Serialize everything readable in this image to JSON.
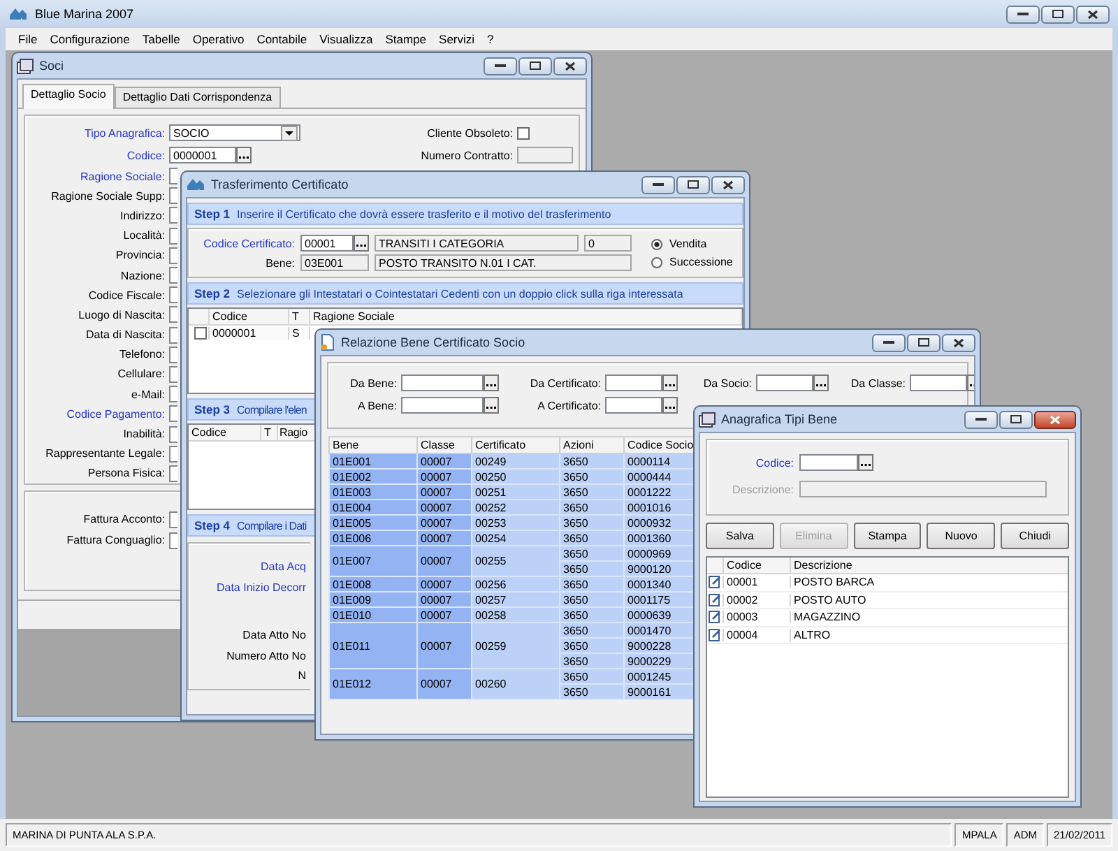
{
  "app": {
    "title": "Blue Marina 2007",
    "menu": [
      "File",
      "Configurazione",
      "Tabelle",
      "Operativo",
      "Contabile",
      "Visualizza",
      "Stampe",
      "Servizi",
      "?"
    ]
  },
  "soci": {
    "title": "Soci",
    "active": false,
    "tabs": [
      {
        "label": "Dettaglio Socio",
        "selected": true
      },
      {
        "label": "Dettaglio Dati Corrispondenza",
        "selected": false
      }
    ],
    "fields": [
      {
        "label": "Tipo Anagrafica:",
        "required": true,
        "kind": "select",
        "value": "SOCIO"
      },
      {
        "label": "Codice:",
        "required": true,
        "kind": "lookup",
        "value": "0000001"
      },
      {
        "label": "Ragione Sociale:",
        "required": true,
        "kind": "covered"
      },
      {
        "label": "Ragione Sociale Supp:",
        "required": false,
        "kind": "covered"
      },
      {
        "label": "Indirizzo:",
        "required": false,
        "kind": "covered"
      },
      {
        "label": "Località:",
        "required": false,
        "kind": "covered"
      },
      {
        "label": "Provincia:",
        "required": false,
        "kind": "covered"
      },
      {
        "label": "Nazione:",
        "required": false,
        "kind": "covered"
      },
      {
        "label": "Codice Fiscale:",
        "required": false,
        "kind": "covered"
      },
      {
        "label": "Luogo di Nascita:",
        "required": false,
        "kind": "covered"
      },
      {
        "label": "Data di Nascita:",
        "required": false,
        "kind": "covered"
      },
      {
        "label": "Telefono:",
        "required": false,
        "kind": "covered"
      },
      {
        "label": "Cellulare:",
        "required": false,
        "kind": "covered"
      },
      {
        "label": "e-Mail:",
        "required": false,
        "kind": "covered"
      },
      {
        "label": "Codice Pagamento:",
        "required": true,
        "kind": "covered"
      },
      {
        "label": "Inabilità:",
        "required": false,
        "kind": "covered"
      },
      {
        "label": "Rappresentante Legale:",
        "required": false,
        "kind": "covered"
      },
      {
        "label": "Persona Fisica:",
        "required": false,
        "kind": "covered"
      }
    ],
    "side_fields": [
      {
        "label": "Cliente Obsoleto:",
        "kind": "checkbox",
        "checked": false
      },
      {
        "label": "Numero Contratto:",
        "kind": "text"
      }
    ],
    "invoice_fields": [
      {
        "label": "Fattura Acconto:",
        "kind": "covered"
      },
      {
        "label": "Fattura Conguaglio:",
        "kind": "covered"
      }
    ]
  },
  "transfer": {
    "title": "Trasferimento Certificato",
    "active": false,
    "steps": [
      {
        "number": "Step 1",
        "text": "Inserire il Certificato che dovrà essere trasferito e il motivo del trasferimento"
      },
      {
        "number": "Step 2",
        "text": "Selezionare gli Intestatari o Cointestatari Cedenti con un doppio click sulla riga interessata"
      },
      {
        "number": "Step 3",
        "text": "Compilare l'elen"
      },
      {
        "number": "Step 4",
        "text": "Compilare i Dati"
      }
    ],
    "certificate": {
      "label": "Codice Certificato:",
      "required": true,
      "value": "00001",
      "description": "TRANSITI I CATEGORIA",
      "quantity": "0"
    },
    "asset": {
      "label": "Bene:",
      "required": false,
      "value": "03E001",
      "description": "POSTO TRANSITO N.01 I CAT."
    },
    "reasons": [
      {
        "label": "Vendita",
        "selected": true
      },
      {
        "label": "Successione",
        "selected": false
      }
    ],
    "holders": {
      "columns": [
        "Codice",
        "T",
        "Ragione Sociale"
      ],
      "rows": [
        {
          "checked": false,
          "cells": [
            "0000001",
            "S"
          ]
        }
      ]
    },
    "assignees": {
      "columns": [
        "Codice",
        "T",
        "Ragio"
      ]
    },
    "step4_fields": [
      {
        "label": "Data Acq",
        "required": true
      },
      {
        "label": "Data Inizio Decorr",
        "required": true
      },
      {
        "label": "Data Atto No",
        "required": false
      },
      {
        "label": "Numero Atto No",
        "required": false
      },
      {
        "label": "N",
        "required": false
      }
    ]
  },
  "relation": {
    "title": "Relazione Bene Certificato Socio",
    "active": false,
    "filter_rows": [
      [
        "Da Bene:",
        "Da Certificato:",
        "Da Socio:",
        "Da Classe:"
      ],
      [
        "A Bene:",
        "A Certificato:"
      ]
    ],
    "columns": [
      "Bene",
      "Classe",
      "Certificato",
      "Azioni",
      "Codice Socio"
    ],
    "groups": [
      {
        "bene": "01E001",
        "classe": "00007",
        "certificato": "00249",
        "members": [
          {
            "azioni": "3650",
            "codice_socio": "0000114"
          }
        ]
      },
      {
        "bene": "01E002",
        "classe": "00007",
        "certificato": "00250",
        "members": [
          {
            "azioni": "3650",
            "codice_socio": "0000444"
          }
        ]
      },
      {
        "bene": "01E003",
        "classe": "00007",
        "certificato": "00251",
        "members": [
          {
            "azioni": "3650",
            "codice_socio": "0001222"
          }
        ]
      },
      {
        "bene": "01E004",
        "classe": "00007",
        "certificato": "00252",
        "members": [
          {
            "azioni": "3650",
            "codice_socio": "0001016"
          }
        ]
      },
      {
        "bene": "01E005",
        "classe": "00007",
        "certificato": "00253",
        "members": [
          {
            "azioni": "3650",
            "codice_socio": "0000932"
          }
        ]
      },
      {
        "bene": "01E006",
        "classe": "00007",
        "certificato": "00254",
        "members": [
          {
            "azioni": "3650",
            "codice_socio": "0001360"
          }
        ]
      },
      {
        "bene": "01E007",
        "classe": "00007",
        "certificato": "00255",
        "members": [
          {
            "azioni": "3650",
            "codice_socio": "0000969"
          },
          {
            "azioni": "3650",
            "codice_socio": "9000120"
          }
        ]
      },
      {
        "bene": "01E008",
        "classe": "00007",
        "certificato": "00256",
        "members": [
          {
            "azioni": "3650",
            "codice_socio": "0001340"
          }
        ]
      },
      {
        "bene": "01E009",
        "classe": "00007",
        "certificato": "00257",
        "members": [
          {
            "azioni": "3650",
            "codice_socio": "0001175"
          }
        ]
      },
      {
        "bene": "01E010",
        "classe": "00007",
        "certificato": "00258",
        "members": [
          {
            "azioni": "3650",
            "codice_socio": "0000639"
          }
        ]
      },
      {
        "bene": "01E011",
        "classe": "00007",
        "certificato": "00259",
        "members": [
          {
            "azioni": "3650",
            "codice_socio": "0001470"
          },
          {
            "azioni": "3650",
            "codice_socio": "9000228"
          },
          {
            "azioni": "3650",
            "codice_socio": "9000229"
          }
        ]
      },
      {
        "bene": "01E012",
        "classe": "00007",
        "certificato": "00260",
        "members": [
          {
            "azioni": "3650",
            "codice_socio": "0001245"
          },
          {
            "azioni": "3650",
            "codice_socio": "9000161"
          }
        ]
      }
    ]
  },
  "types": {
    "title": "Anagrafica Tipi Bene",
    "active": true,
    "code": {
      "label": "Codice:",
      "required": true
    },
    "description": {
      "label": "Descrizione:",
      "disabled": true
    },
    "buttons": [
      {
        "label": "Salva",
        "disabled": false
      },
      {
        "label": "Elimina",
        "disabled": true
      },
      {
        "label": "Stampa",
        "disabled": false
      },
      {
        "label": "Nuovo",
        "disabled": false
      },
      {
        "label": "Chiudi",
        "disabled": false
      }
    ],
    "columns": [
      "Codice",
      "Descrizione"
    ],
    "rows": [
      [
        "00001",
        "POSTO BARCA"
      ],
      [
        "00002",
        "POSTO AUTO"
      ],
      [
        "00003",
        "MAGAZZINO"
      ],
      [
        "00004",
        "ALTRO"
      ]
    ]
  },
  "status_bar": [
    "MARINA DI PUNTA ALA S.P.A.",
    "MPALA",
    "ADM",
    "21/02/2011"
  ]
}
